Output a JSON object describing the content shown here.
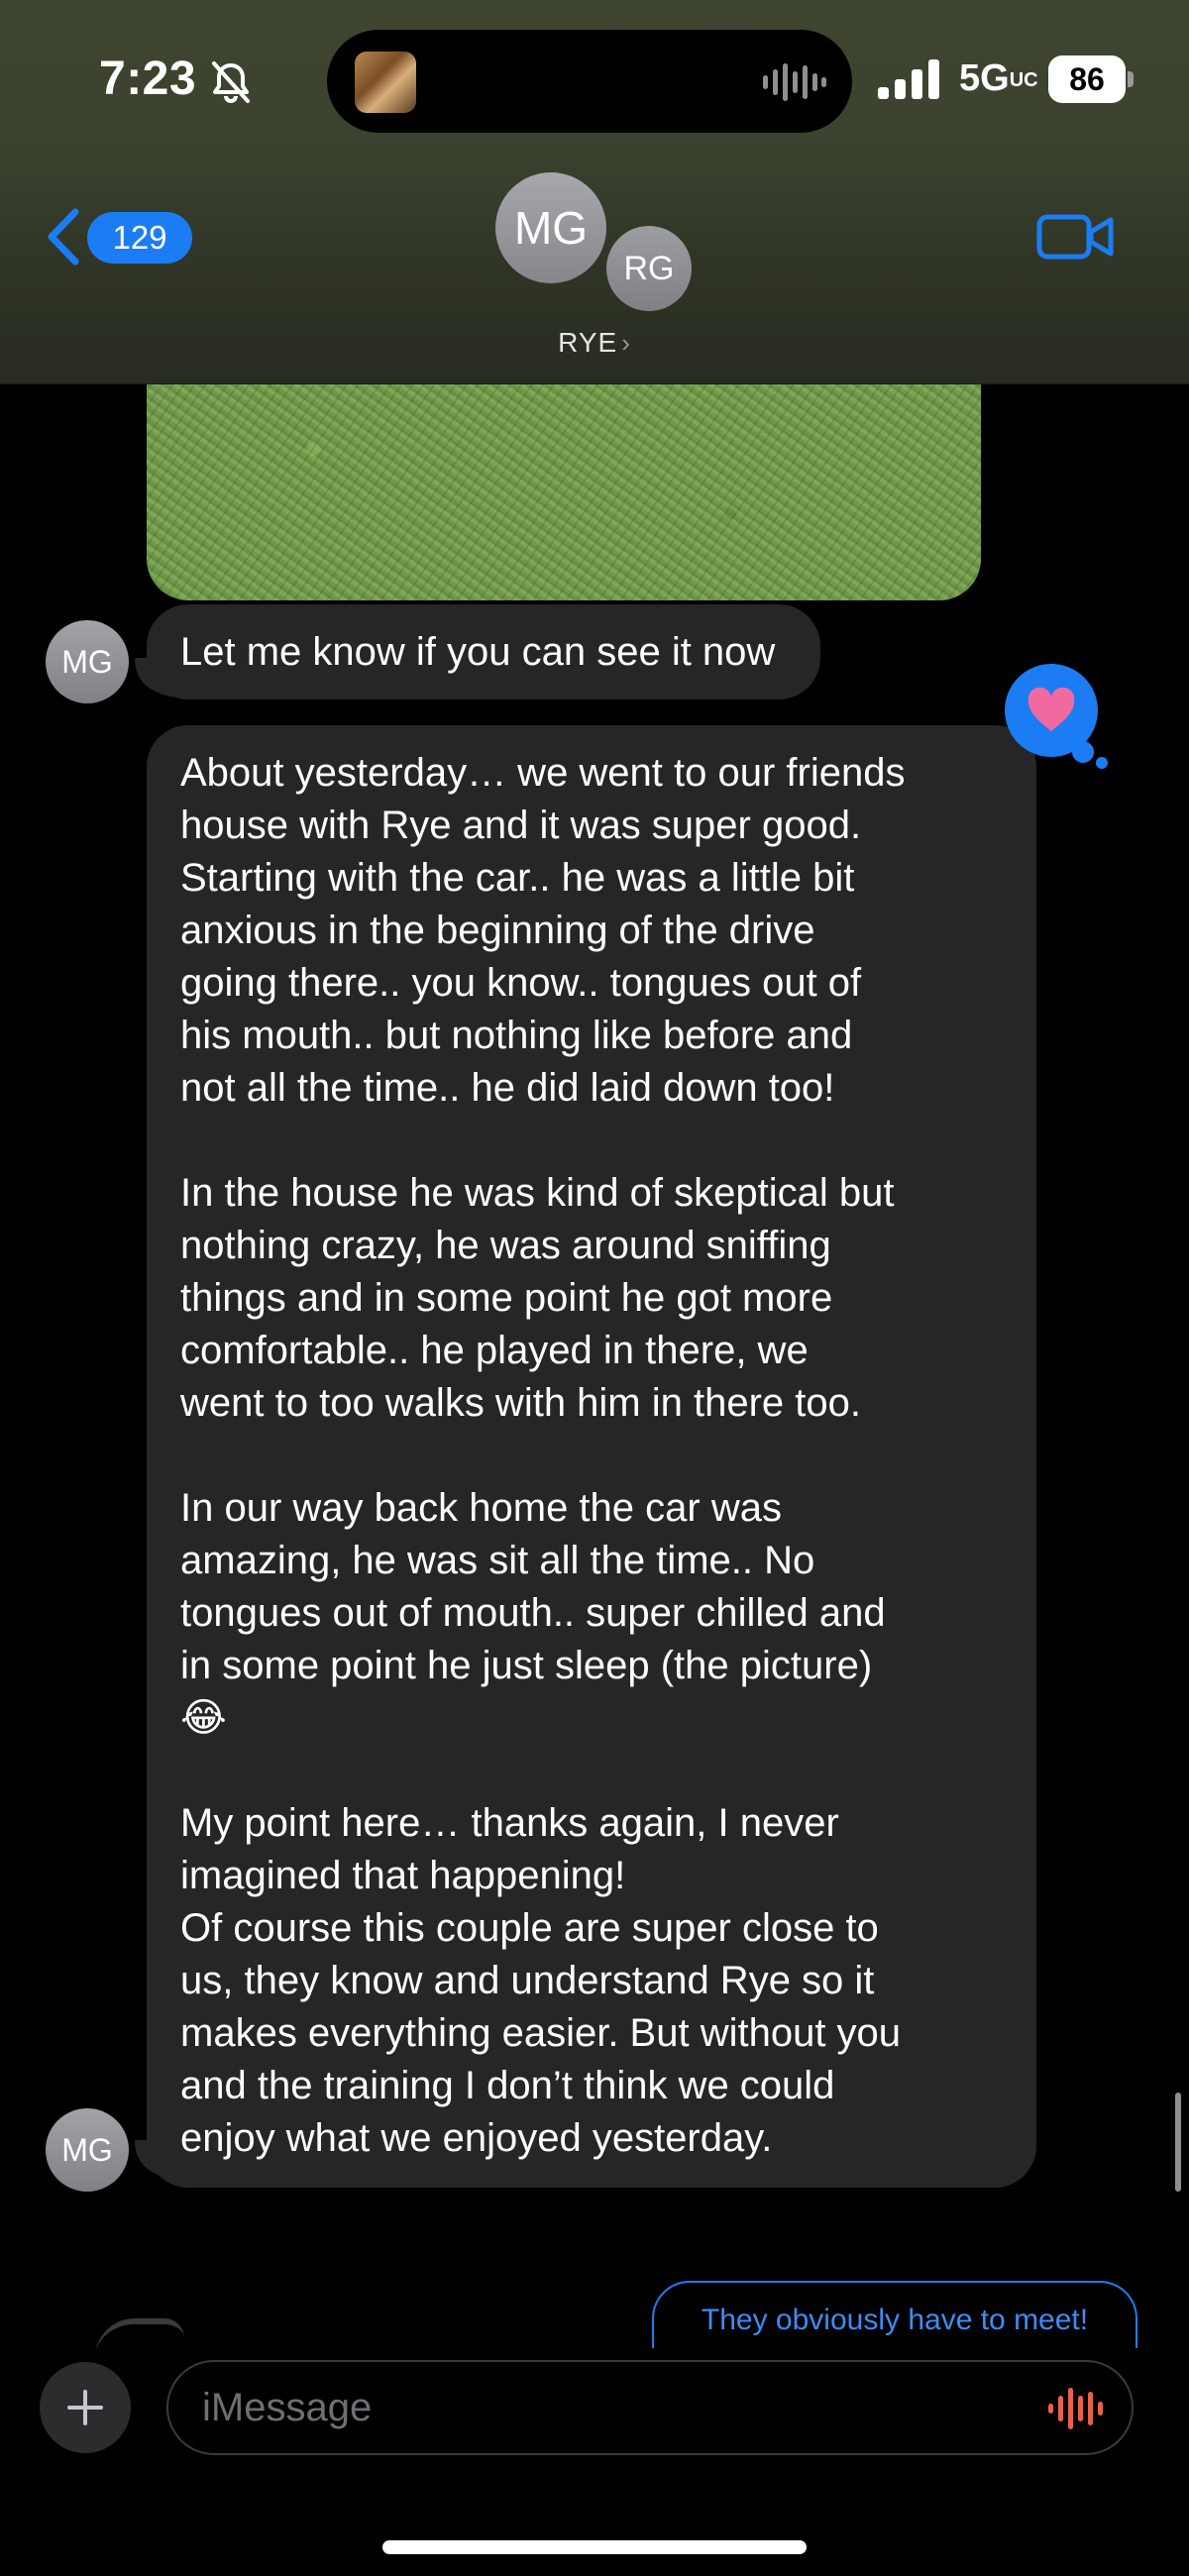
{
  "status_bar": {
    "time": "7:23",
    "network": "5G",
    "network_suffix": "UC",
    "battery": "86",
    "icons": [
      "bell-slash-icon",
      "cellular-signal-icon",
      "battery-icon",
      "audio-waveform-icon"
    ]
  },
  "header": {
    "back_badge": "129",
    "avatars": [
      "MG",
      "RG"
    ],
    "contact_name": "RYE",
    "chevron": "›",
    "icons": [
      "back-chevron-icon",
      "video-camera-icon"
    ],
    "accent_color": "#1c7cf4"
  },
  "messages": [
    {
      "id": "m1",
      "type": "image",
      "description_key": "grass-photo"
    },
    {
      "id": "m2",
      "sender": "MG",
      "text": "Let me know if you can see it now"
    },
    {
      "id": "m3",
      "sender": "MG",
      "reaction": "heart",
      "paragraphs": [
        "About yesterday… we went to our friends\nhouse with Rye and it was super good.\nStarting with the car.. he was a little bit\nanxious in the beginning of the drive\ngoing there.. you know.. tongues out of\nhis mouth.. but nothing like before and\nnot all the time.. he did laid down too!",
        "In the house he was kind of skeptical but\nnothing crazy, he was around sniffing\nthings and in some point he got more\ncomfortable.. he played in there, we\nwent to too walks with him in there too.",
        "In our way back home the car was\namazing, he was sit all the time.. No\ntongues out of mouth.. super chilled and\nin some point he just sleep (the picture)\n😂",
        "My point here… thanks again, I never\nimagined that happening!\nOf course this couple are super close to\nus, they know and understand Rye so it\nmakes everything easier. But without you\nand the training I don’t think we could\nenjoy what we enjoyed yesterday."
      ]
    },
    {
      "id": "m4",
      "sender": "me",
      "text": "They obviously have to meet!"
    }
  ],
  "composer": {
    "placeholder": "iMessage",
    "icons": [
      "plus-icon",
      "audio-waveform-icon"
    ]
  }
}
